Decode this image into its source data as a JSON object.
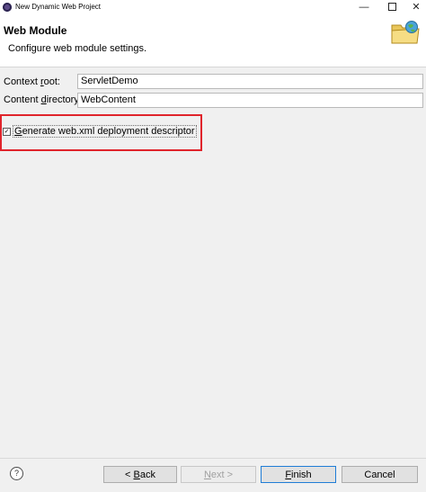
{
  "window": {
    "title": "New Dynamic Web Project",
    "minimize_glyph": "—",
    "close_glyph": "✕"
  },
  "header": {
    "title": "Web Module",
    "description": "Configure web module settings.",
    "icon": "folder-globe-icon"
  },
  "form": {
    "context_root_label": {
      "pre": "Context ",
      "mnemonic": "r",
      "post": "oot:"
    },
    "context_root_value": "ServletDemo",
    "content_dir_label": {
      "pre": "Content ",
      "mnemonic": "d",
      "post": "irectory:"
    },
    "content_dir_value": "WebContent"
  },
  "checkbox": {
    "mnemonic": "G",
    "label_rest": "enerate web.xml deployment descriptor",
    "checked": true,
    "check_glyph": "✓"
  },
  "highlight_color": "#e0242b",
  "buttons": {
    "help_glyph": "?",
    "back": {
      "pre": "< ",
      "mnemonic": "B",
      "post": "ack"
    },
    "next": {
      "pre": "",
      "mnemonic": "N",
      "post": "ext >"
    },
    "finish": {
      "pre": "",
      "mnemonic": "F",
      "post": "inish"
    },
    "cancel": "Cancel"
  }
}
